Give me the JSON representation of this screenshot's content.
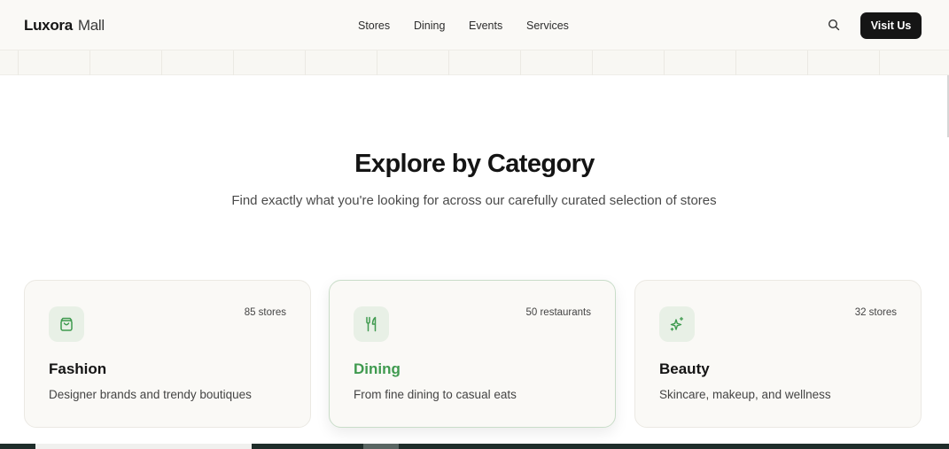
{
  "header": {
    "brand": "Luxora",
    "brand_sub": "Mall",
    "nav": [
      "Stores",
      "Dining",
      "Events",
      "Services"
    ],
    "cta_label": "Visit Us",
    "search_icon": "search-icon"
  },
  "section": {
    "title": "Explore by Category",
    "subtitle": "Find exactly what you're looking for across our carefully curated selection of stores"
  },
  "categories": [
    {
      "name": "Fashion",
      "count": "85 stores",
      "description": "Designer brands and trendy boutiques",
      "icon": "shopping-bag-icon"
    },
    {
      "name": "Dining",
      "count": "50 restaurants",
      "description": "From fine dining to casual eats",
      "icon": "utensils-icon"
    },
    {
      "name": "Beauty",
      "count": "32 stores",
      "description": "Skincare, makeup, and wellness",
      "icon": "sparkles-icon"
    }
  ],
  "colors": {
    "accent_green": "#3f9a4f",
    "icon_bg": "#e8f0e6",
    "button_bg": "#151515",
    "card_bg": "#faf9f6"
  }
}
